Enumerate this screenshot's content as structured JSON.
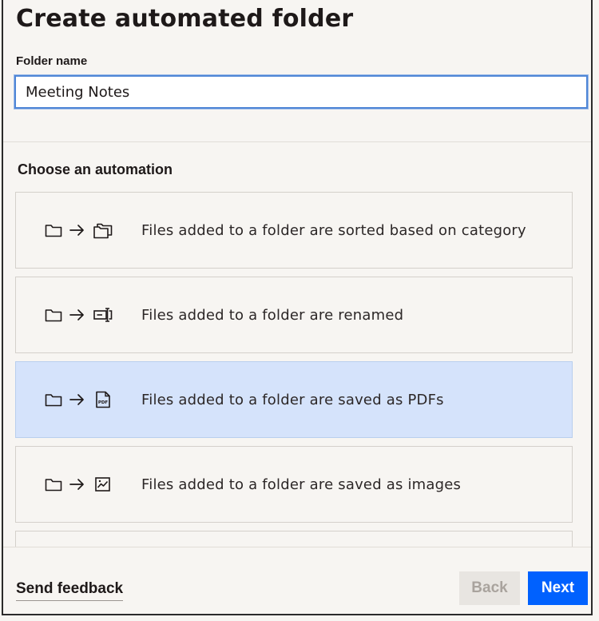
{
  "dialog": {
    "title": "Create automated folder",
    "folder_name_label": "Folder name",
    "folder_name_value": "Meeting Notes",
    "section_title": "Choose an automation"
  },
  "automations": [
    {
      "label": "Files added to a folder are sorted based on category",
      "target_icon": "folders-icon",
      "selected": false
    },
    {
      "label": "Files added to a folder are renamed",
      "target_icon": "rename-icon",
      "selected": false
    },
    {
      "label": "Files added to a folder are saved as PDFs",
      "target_icon": "pdf-file-icon",
      "selected": true
    },
    {
      "label": "Files added to a folder are saved as images",
      "target_icon": "image-icon",
      "selected": false
    }
  ],
  "footer": {
    "feedback_label": "Send feedback",
    "back_label": "Back",
    "next_label": "Next"
  },
  "colors": {
    "background": "#f7f5f2",
    "selected_option": "#d5e3fb",
    "primary_button": "#0061fe",
    "input_focus_border": "#4f86d6"
  }
}
